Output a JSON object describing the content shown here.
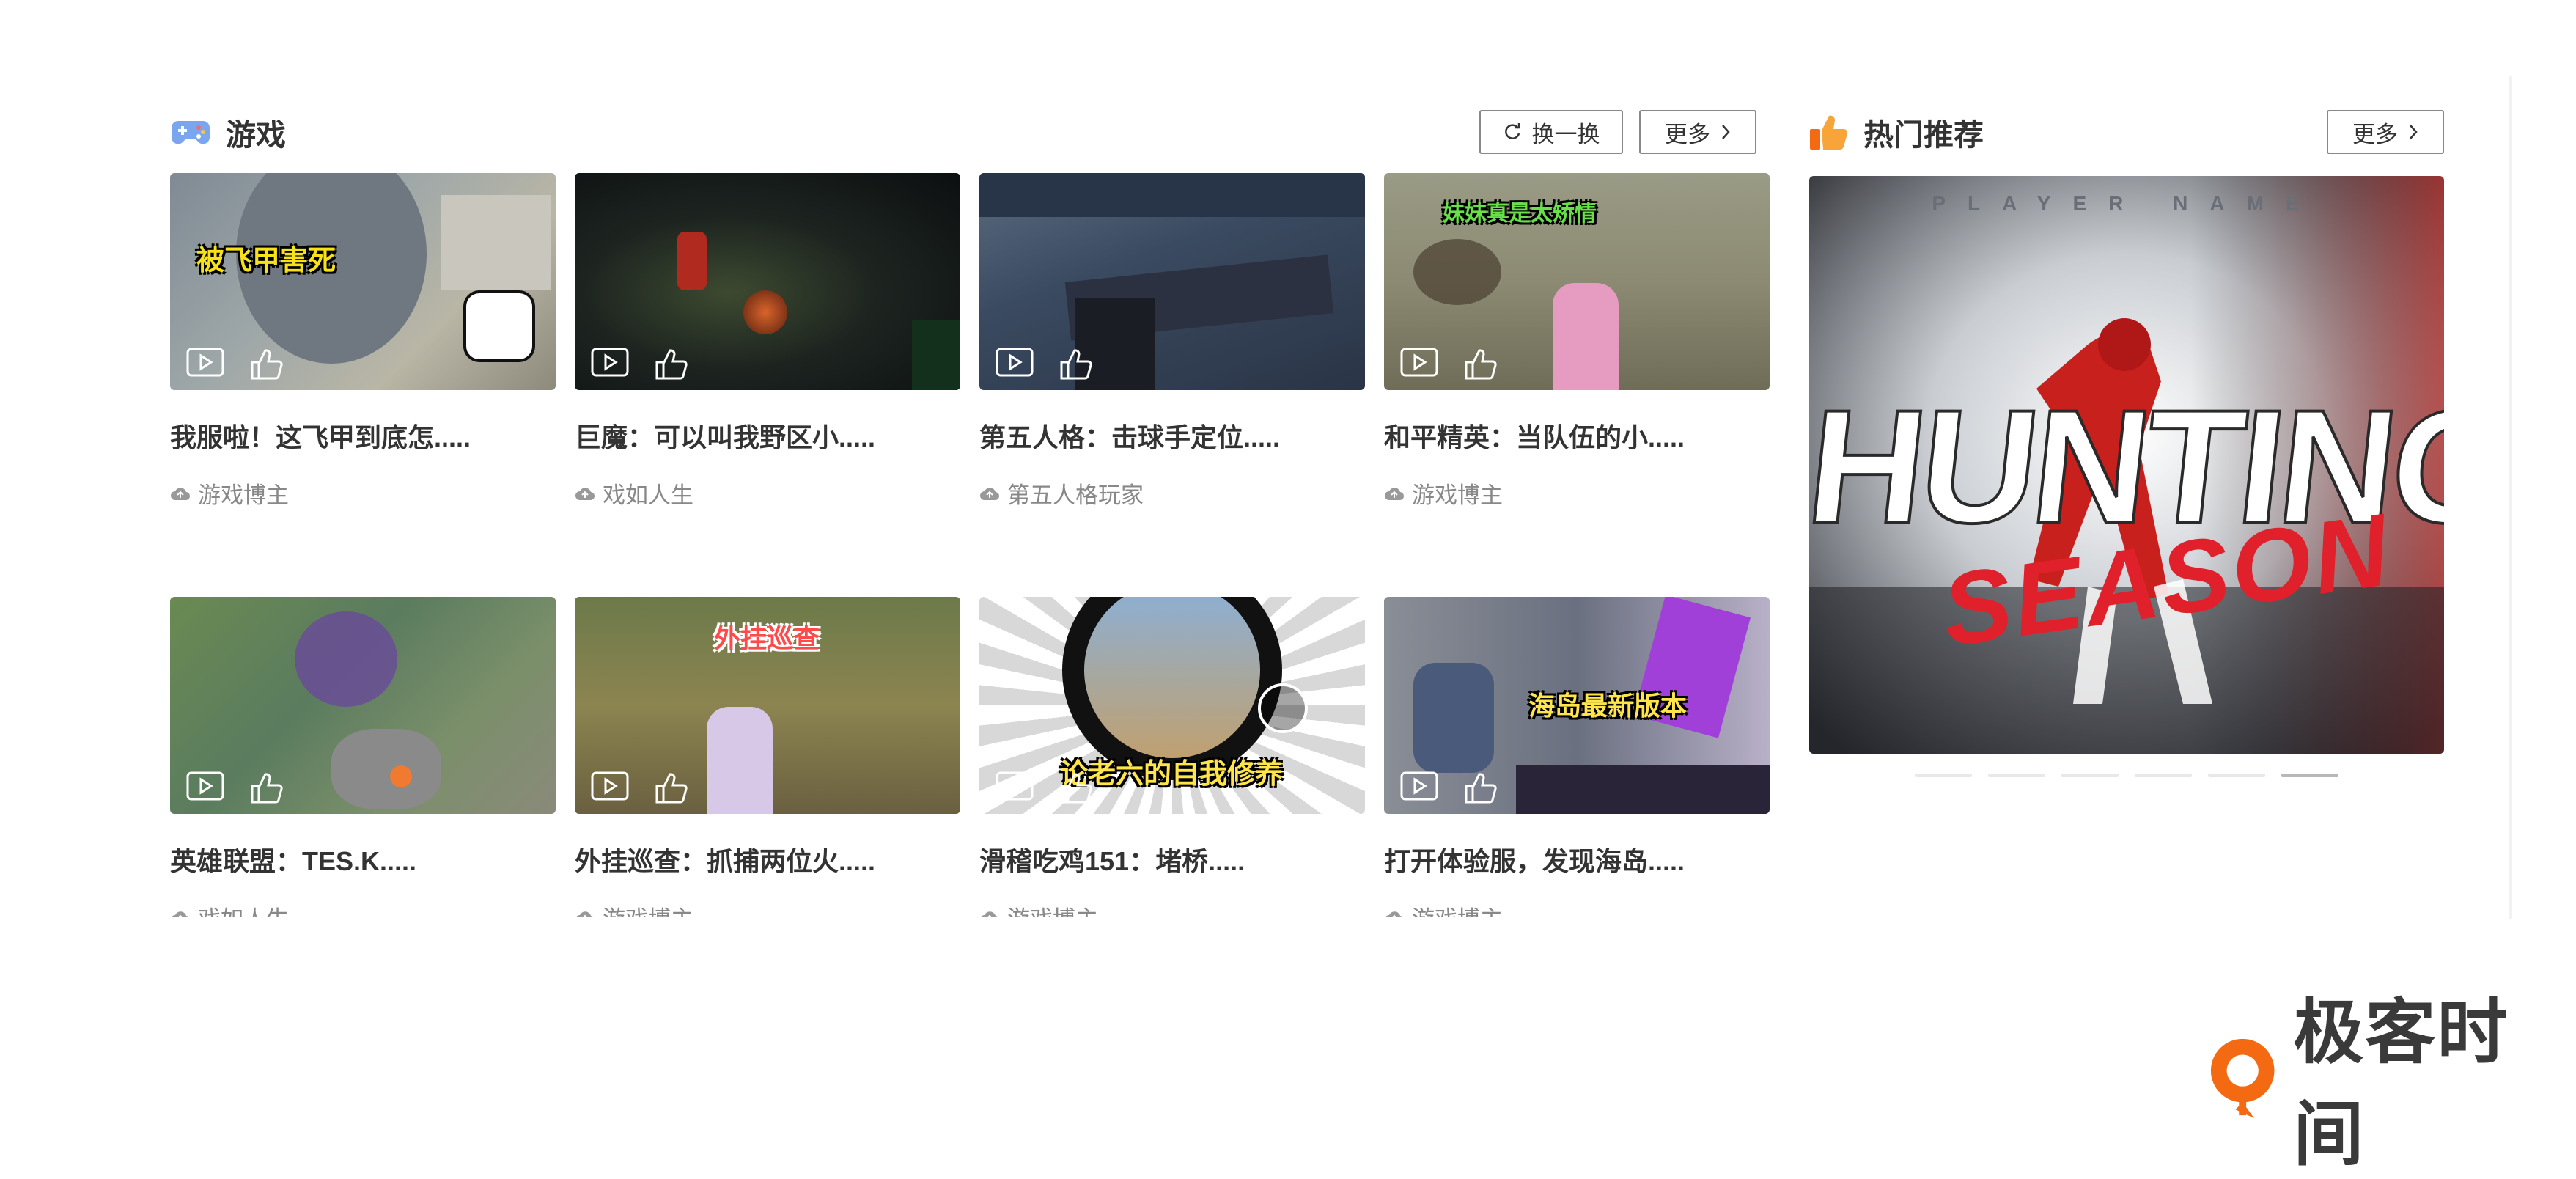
{
  "games_section": {
    "title": "游戏",
    "refresh_label": "换一换",
    "more_label": "更多",
    "videos": [
      {
        "title": "我服啦！这飞甲到底怎.....",
        "author": "游戏博主",
        "overlay_text": "被飞甲害死"
      },
      {
        "title": "巨魔：可以叫我野区小.....",
        "author": "戏如人生",
        "overlay_text": ""
      },
      {
        "title": "第五人格：击球手定位.....",
        "author": "第五人格玩家",
        "overlay_text": ""
      },
      {
        "title": "和平精英：当队伍的小.....",
        "author": "游戏博主",
        "overlay_text": "妹妹真是太矫情"
      },
      {
        "title": "英雄联盟：TES.K.....",
        "author": "戏如人生",
        "overlay_text": ""
      },
      {
        "title": "外挂巡查：抓捕两位火.....",
        "author": "游戏博主",
        "overlay_text": "外挂巡查"
      },
      {
        "title": "滑稽吃鸡151：堵桥.....",
        "author": "游戏博主",
        "overlay_text": "论老六的自我修养"
      },
      {
        "title": "打开体验服，发现海岛.....",
        "author": "游戏博主",
        "overlay_text": "海岛最新版本"
      }
    ]
  },
  "hot_section": {
    "title": "热门推荐",
    "more_label": "更多",
    "banner": {
      "top_text": "PLAYER NAME",
      "main_text": "HUNTING",
      "script_text": "SEASON"
    },
    "slide_count": 6,
    "active_slide": 6
  },
  "watermark": {
    "text": "极客时间"
  },
  "colors": {
    "accent_orange": "#f36a12",
    "text_dark": "#333333",
    "text_muted": "#888888",
    "border": "#888888"
  }
}
